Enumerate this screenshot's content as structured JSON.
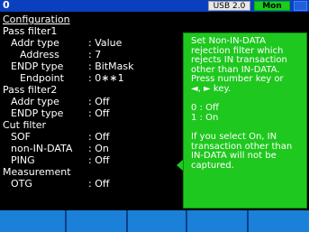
{
  "topbar": {
    "number": "0",
    "usb": "USB 2.0",
    "mode": "Mon"
  },
  "title": "Configuration",
  "items": [
    {
      "label": "Pass filter1",
      "value": "",
      "indent": 0
    },
    {
      "label": "Addr type",
      "value": ": Value",
      "indent": 1
    },
    {
      "label": "Address",
      "value": ":   7",
      "indent": 2
    },
    {
      "label": "ENDP type",
      "value": ": BitMask",
      "indent": 1
    },
    {
      "label": "Endpoint",
      "value": ": 0∗∗1",
      "indent": 2
    },
    {
      "label": "Pass filter2",
      "value": "",
      "indent": 0
    },
    {
      "label": "Addr type",
      "value": ": Off",
      "indent": 1
    },
    {
      "label": "ENDP type",
      "value": ": Off",
      "indent": 1
    },
    {
      "label": "Cut filter",
      "value": "",
      "indent": 0
    },
    {
      "label": "SOF",
      "value": ": Off",
      "indent": 1
    },
    {
      "label": "non-IN-DATA",
      "value": ": On",
      "indent": 1
    },
    {
      "label": "PING",
      "value": ": Off",
      "indent": 1
    },
    {
      "label": "Measurement",
      "value": "",
      "indent": 0
    },
    {
      "label": "OTG",
      "value": ": Off",
      "indent": 1
    }
  ],
  "help": {
    "lines": [
      "Set Non-IN-DATA",
      "rejection filter which",
      "rejects IN transaction",
      "other than IN-DATA.",
      "Press number key or",
      "◄, ► key.",
      "",
      "0 : Off",
      "1 : On",
      "",
      "If you select On, IN",
      "transaction other than",
      "IN-DATA will not be",
      "captured."
    ]
  },
  "colors": {
    "background": "#000000",
    "topbar": "#0a40c0",
    "panel": "#1fc81f",
    "buttons": "#1a80d8"
  }
}
